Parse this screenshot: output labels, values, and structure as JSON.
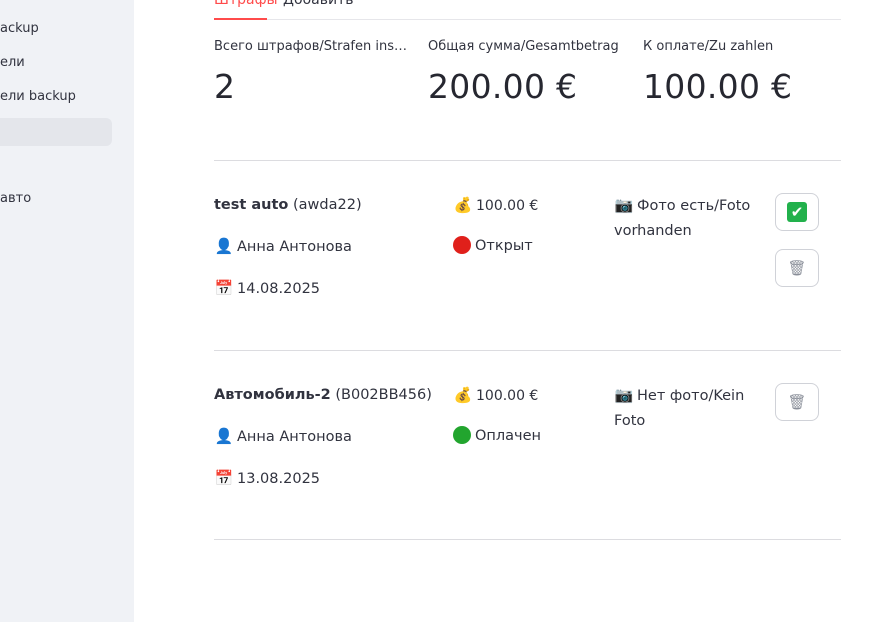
{
  "sidebar": {
    "items": [
      {
        "label": "ackup",
        "active": false
      },
      {
        "label": "ели",
        "active": false
      },
      {
        "label": "ели backup",
        "active": false
      },
      {
        "label": "",
        "active": true
      },
      {
        "label": "",
        "active": false
      },
      {
        "label": "авто",
        "active": false
      },
      {
        "label": "",
        "active": false
      }
    ]
  },
  "tabs": [
    {
      "label": "Штрафы",
      "active": true
    },
    {
      "label": "Добавить",
      "active": false
    }
  ],
  "metrics": [
    {
      "label": "Всего штрафов/Strafen insgesamt",
      "value": "2"
    },
    {
      "label": "Общая сумма/Gesamtbetrag",
      "value": "200.00 €"
    },
    {
      "label": "К оплате/Zu zahlen",
      "value": "100.00 €"
    }
  ],
  "fines": [
    {
      "car": "test auto",
      "plate": "(awda22)",
      "driver": "Анна Антонова",
      "date": "14.08.2025",
      "amount": "100.00 €",
      "status": "Открыт",
      "status_color": "#e0201b",
      "photo": "Фото есть/Foto vorhanden",
      "has_pay_button": true
    },
    {
      "car": "Автомобиль-2",
      "plate": "(B002BB456)",
      "driver": "Анна Антонова",
      "date": "13.08.2025",
      "amount": "100.00 €",
      "status": "Оплачен",
      "status_color": "#22a52e",
      "photo": "Нет фото/Kein Foto",
      "has_pay_button": false
    }
  ],
  "icons": {
    "money": "💰",
    "person": "👤",
    "calendar": "📅",
    "camera": "📷",
    "check": "✔",
    "trash": "🗑"
  },
  "colors": {
    "accent": "#ff4b4b",
    "check_bg": "#22b14c"
  }
}
